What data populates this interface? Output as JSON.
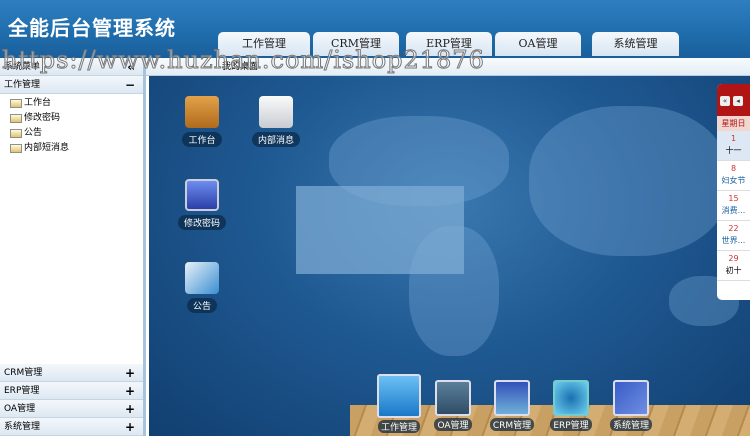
{
  "header": {
    "title": "全能后台管理系统",
    "tabs": [
      "工作管理",
      "CRM管理",
      "ERP管理",
      "OA管理",
      "系统管理"
    ]
  },
  "sidebar": {
    "title": "系统菜单",
    "collapse": "«",
    "groups": [
      {
        "label": "工作管理",
        "toggle": "−",
        "items": [
          "工作台",
          "修改密码",
          "公告",
          "内部短消息"
        ]
      },
      {
        "label": "CRM管理",
        "toggle": "+"
      },
      {
        "label": "ERP管理",
        "toggle": "+"
      },
      {
        "label": "OA管理",
        "toggle": "+"
      },
      {
        "label": "系统管理",
        "toggle": "+"
      }
    ]
  },
  "breadcrumb": "我的桌面",
  "desktop": {
    "icons": [
      "工作台",
      "内部消息",
      "修改密码",
      "公告"
    ]
  },
  "calendar": {
    "nav": [
      "«",
      "◂"
    ],
    "weekday": "星期日",
    "days": [
      {
        "n": "1",
        "t": "十一"
      },
      {
        "n": "8",
        "t": "妇女节"
      },
      {
        "n": "15",
        "t": "消费..."
      },
      {
        "n": "22",
        "t": "世界..."
      },
      {
        "n": "29",
        "t": "初十"
      }
    ]
  },
  "dock": [
    "工作管理",
    "OA管理",
    "CRM管理",
    "ERP管理",
    "系统管理"
  ],
  "watermark": "https://www.huzhan.com/ishop21876"
}
